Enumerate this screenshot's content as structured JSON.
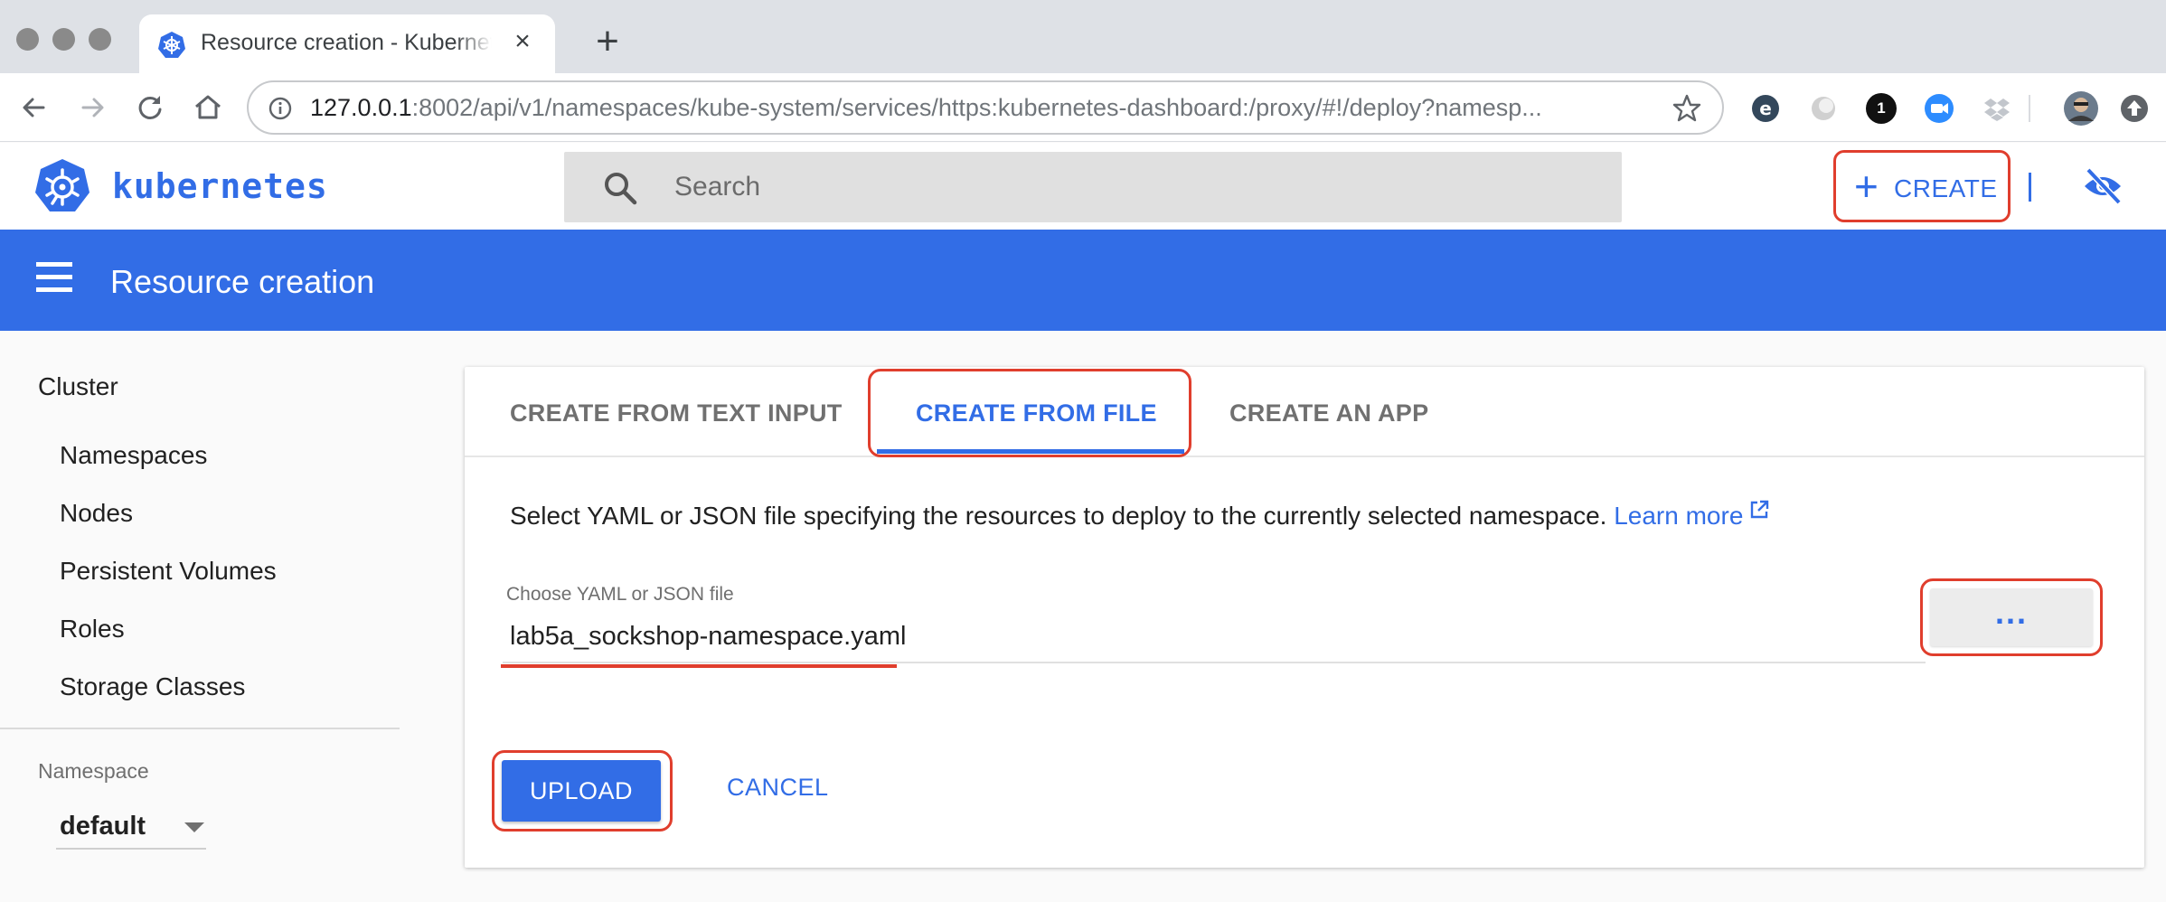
{
  "browser": {
    "tab_title": "Resource creation - Kubernetes Dashboard",
    "close_glyph": "×",
    "new_tab_glyph": "+",
    "url_host": "127.0.0.1",
    "url_rest": ":8002/api/v1/namespaces/kube-system/services/https:kubernetes-dashboard:/proxy/#!/deploy?namesp...",
    "extension_badge": "1"
  },
  "header": {
    "brand": "kubernetes",
    "search_placeholder": "Search",
    "create_plus": "+",
    "create_label": "CREATE"
  },
  "titlebar": {
    "title": "Resource creation"
  },
  "sidebar": {
    "section": "Cluster",
    "items": [
      {
        "label": "Namespaces"
      },
      {
        "label": "Nodes"
      },
      {
        "label": "Persistent Volumes"
      },
      {
        "label": "Roles"
      },
      {
        "label": "Storage Classes"
      }
    ],
    "namespace_label": "Namespace",
    "namespace_value": "default"
  },
  "main": {
    "tabs": [
      {
        "label": "CREATE FROM TEXT INPUT"
      },
      {
        "label": "CREATE FROM FILE"
      },
      {
        "label": "CREATE AN APP"
      }
    ],
    "active_tab": "CREATE FROM FILE",
    "description": "Select YAML or JSON file specifying the resources to deploy to the currently selected namespace.",
    "learn_more": "Learn more",
    "file_label": "Choose YAML or JSON file",
    "file_value": "lab5a_sockshop-namespace.yaml",
    "browse_label": "...",
    "upload_label": "UPLOAD",
    "cancel_label": "CANCEL"
  },
  "colors": {
    "accent": "#326de6",
    "highlight": "#e03e2d"
  }
}
